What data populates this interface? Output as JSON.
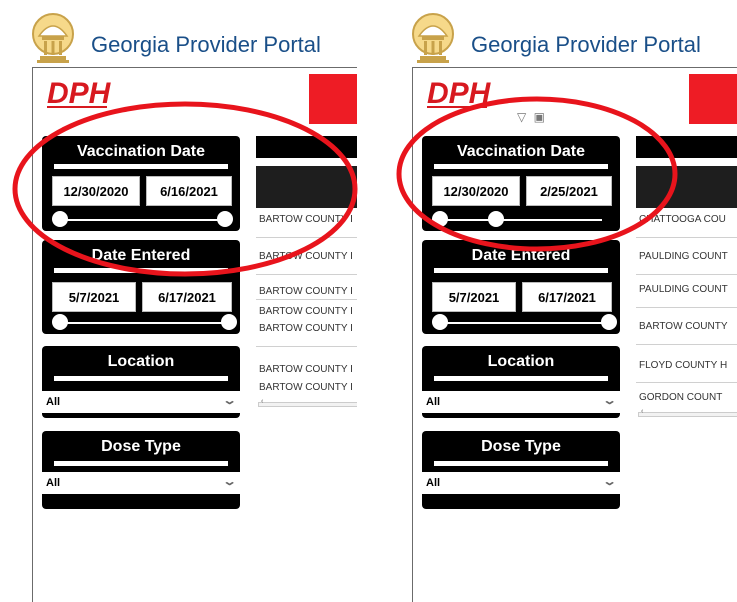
{
  "portal": {
    "title": "Georgia Provider Portal"
  },
  "logo": {
    "text": "DPH"
  },
  "panels": [
    {
      "vaccination_date": {
        "title": "Vaccination Date",
        "start": "12/30/2020",
        "end": "6/16/2021"
      },
      "date_entered": {
        "title": "Date Entered",
        "start": "5/7/2021",
        "end": "6/17/2021"
      },
      "location": {
        "title": "Location",
        "value": "All"
      },
      "dose_type": {
        "title": "Dose Type",
        "value": "All"
      },
      "table_rows": [
        "BARTOW COUNTY I",
        "BARTOW COUNTY I",
        "BARTOW COUNTY I",
        "BARTOW COUNTY I",
        "BARTOW COUNTY I",
        "BARTOW COUNTY I",
        "BARTOW COUNTY I"
      ]
    },
    {
      "vaccination_date": {
        "title": "Vaccination Date",
        "start": "12/30/2020",
        "end": "2/25/2021"
      },
      "date_entered": {
        "title": "Date Entered",
        "start": "5/7/2021",
        "end": "6/17/2021"
      },
      "location": {
        "title": "Location",
        "value": "All"
      },
      "dose_type": {
        "title": "Dose Type",
        "value": "All"
      },
      "table_rows": [
        "CHATTOOGA COU",
        "PAULDING COUNT",
        "PAULDING COUNT",
        "BARTOW COUNTY",
        "FLOYD COUNTY H",
        "GORDON COUNT"
      ]
    }
  ],
  "icons": {
    "filter": "filter-icon",
    "focus": "focus-mode-icon",
    "scroll_left": "chevron-left-icon",
    "dropdown": "chevron-down-icon"
  },
  "colors": {
    "title_blue": "#1a4f88",
    "annotation_red": "#e8141c",
    "slicer_bg": "#000000",
    "logo_red": "#ee1c25"
  }
}
